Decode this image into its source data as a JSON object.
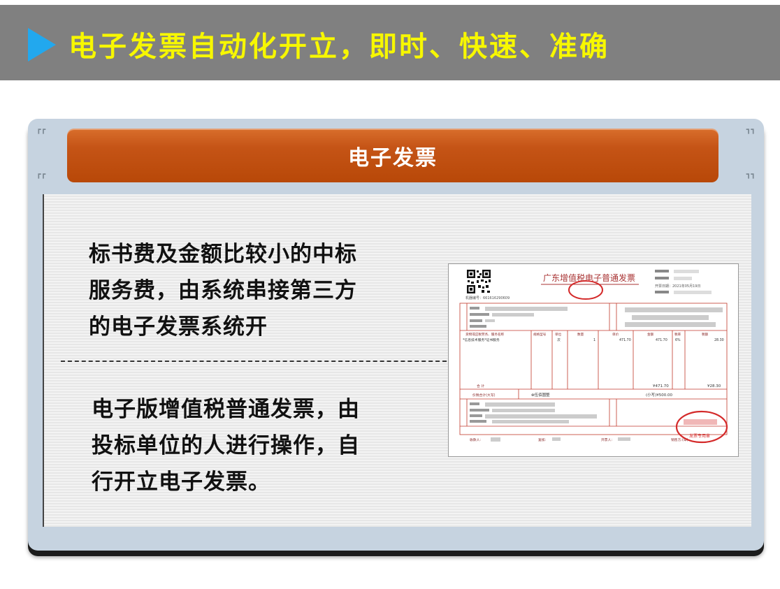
{
  "header": {
    "title": "电子发票自动化开立，即时、快速、准确"
  },
  "banner": {
    "label": "电子发票"
  },
  "text_block_1": [
    "标书费及金额比较小的中标",
    "服务费，由系统串接第三方",
    "的电子发票系统开"
  ],
  "text_block_2": [
    "电子版增值税普通发票，由",
    "投标单位的人进行操作，自",
    "行开立电子发票。"
  ],
  "invoice": {
    "heading": "广东增值税电子普通发票",
    "machine_no": "机器编号：661616290609",
    "issue_date": "开票日期：2021年05月19日",
    "item_header": [
      "货物或应税劳务、服务名称",
      "规格型号",
      "单位",
      "数量",
      "单价",
      "金额",
      "税率",
      "税额"
    ],
    "item_name": "*信息技术服务*证书服务",
    "item_unit": "次",
    "item_qty": "1",
    "item_price": "471.70",
    "item_amount": "471.70",
    "item_rate": "6%",
    "item_tax": "28.30",
    "total_row_label": "合    计",
    "total_amount": "¥471.70",
    "total_tax": "¥28.30",
    "total_words_label": "价税合计(大写)",
    "total_words": "⊗伍佰圆整",
    "total_small": "(小写)¥500.00",
    "payee_label": "收款人:",
    "reviewer_label": "复核:",
    "drawer_label": "开票人:",
    "seller_label": "销售方:(章)",
    "stamp_text": "发票专用章"
  },
  "colors": {
    "header_bg": "#808080",
    "title_yellow": "#f7f700",
    "triangle": "#22a8ee",
    "banner_orange": "#c55416",
    "invoice_red": "#c0392b"
  }
}
